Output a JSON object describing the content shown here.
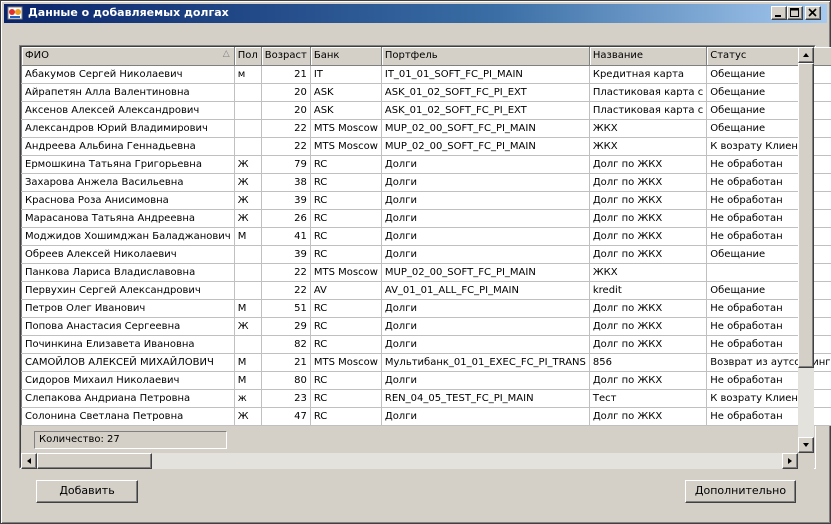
{
  "window": {
    "title": "Данные о добавляемых долгах"
  },
  "grid": {
    "columns": [
      "ФИО",
      "Пол",
      "Возраст",
      "Банк",
      "Портфель",
      "Название",
      "Статус"
    ],
    "sort_indicator": "△",
    "rows": [
      [
        "Абакумов Сергей Николаевич",
        "м",
        "21",
        "IT",
        "IT_01_01_SOFT_FC_PI_MAIN",
        "Кредитная карта",
        "Обещание"
      ],
      [
        "Айрапетян Алла Валентиновна",
        "",
        "20",
        "ASK",
        "ASK_01_02_SOFT_FC_PI_EXT",
        "Пластиковая карта с",
        "Обещание"
      ],
      [
        "Аксенов Алексей Александрович",
        "",
        "20",
        "ASK",
        "ASK_01_02_SOFT_FC_PI_EXT",
        "Пластиковая карта с",
        "Обещание"
      ],
      [
        "Александров Юрий Владимирович",
        "",
        "22",
        "MTS Moscow",
        "MUP_02_00_SOFT_FC_PI_MAIN",
        "ЖКХ",
        "Обещание"
      ],
      [
        "Андреева Альбина Геннадьевна",
        "",
        "22",
        "MTS Moscow",
        "MUP_02_00_SOFT_FC_PI_MAIN",
        "ЖКХ",
        "К возрату Клиенту"
      ],
      [
        "Ермошкина Татьяна Григорьевна",
        "Ж",
        "79",
        "RC",
        "Долги",
        "Долг по ЖКХ",
        "Не обработан"
      ],
      [
        "Захарова Анжела Васильевна",
        "Ж",
        "38",
        "RC",
        "Долги",
        "Долг по ЖКХ",
        "Не обработан"
      ],
      [
        "Краснова Роза Анисимовна",
        "Ж",
        "39",
        "RC",
        "Долги",
        "Долг по ЖКХ",
        "Не обработан"
      ],
      [
        "Марасанова Татьяна Андреевна",
        "Ж",
        "26",
        "RC",
        "Долги",
        "Долг по ЖКХ",
        "Не обработан"
      ],
      [
        "Моджидов Хошимджан Баладжанович",
        "М",
        "41",
        "RC",
        "Долги",
        "Долг по ЖКХ",
        "Не обработан"
      ],
      [
        "Обреев Алексей Николаевич",
        "",
        "39",
        "RC",
        "Долги",
        "Долг по ЖКХ",
        "Обещание"
      ],
      [
        "Панкова Лариса Владиславовна",
        "",
        "22",
        "MTS Moscow",
        "MUP_02_00_SOFT_FC_PI_MAIN",
        "ЖКХ",
        ""
      ],
      [
        "Первухин Сергей Александрович",
        "",
        "22",
        "AV",
        "AV_01_01_ALL_FC_PI_MAIN",
        "kredit",
        "Обещание"
      ],
      [
        "Петров Олег Иванович",
        "М",
        "51",
        "RC",
        "Долги",
        "Долг по ЖКХ",
        "Не обработан"
      ],
      [
        "Попова Анастасия Сергеевна",
        "Ж",
        "29",
        "RC",
        "Долги",
        "Долг по ЖКХ",
        "Не обработан"
      ],
      [
        "Починкина Елизавета Ивановна",
        "",
        "82",
        "RC",
        "Долги",
        "Долг по ЖКХ",
        "Не обработан"
      ],
      [
        "САМОЙЛОВ АЛЕКСЕЙ МИХАЙЛОВИЧ",
        "М",
        "21",
        "MTS Moscow",
        "Мультибанк_01_01_EXEC_FC_PI_TRANS",
        "856",
        "Возврат из аутсорсинга"
      ],
      [
        "Сидоров Михаил Николаевич",
        "М",
        "80",
        "RC",
        "Долги",
        "Долг по ЖКХ",
        "Не обработан"
      ],
      [
        "Слепакова Андриана Петровна",
        "ж",
        "23",
        "RC",
        "REN_04_05_TEST_FC_PI_MAIN",
        "Тест",
        "К возрату Клиенту"
      ],
      [
        "Солонина Светлана Петровна",
        "Ж",
        "47",
        "RC",
        "Долги",
        "Долг по ЖКХ",
        "Не обработан"
      ]
    ]
  },
  "status": {
    "count_label": "Количество: 27"
  },
  "buttons": {
    "add": "Добавить",
    "more": "Дополнительно"
  }
}
